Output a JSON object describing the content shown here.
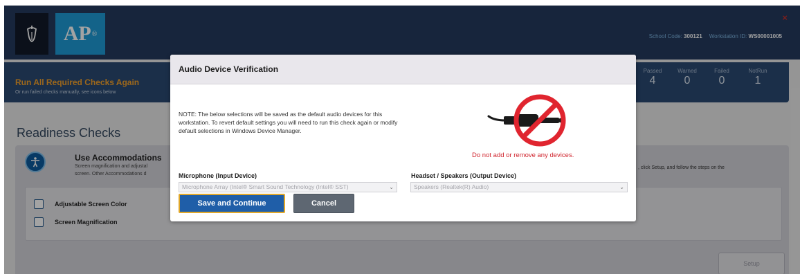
{
  "header": {
    "logo_text": "AP",
    "logo_mark": "®",
    "close_label": "×",
    "school_code_label": "School Code:",
    "school_code_value": "300121",
    "workstation_label": "Workstation ID:",
    "workstation_value": "WS00001005"
  },
  "run_bar": {
    "title": "Run All Required Checks Again",
    "subtitle": "Or run failed checks manually, see icons below",
    "stats": [
      {
        "label": "Passed",
        "value": "4"
      },
      {
        "label": "Warned",
        "value": "0"
      },
      {
        "label": "Failed",
        "value": "0"
      },
      {
        "label": "NotRun",
        "value": "1"
      }
    ]
  },
  "readiness": {
    "title": "Readiness Checks",
    "accommodations": {
      "title": "Use Accommodations",
      "desc_line1": "Screen magnification and adjustal",
      "desc_line2": "screen. Other Accommodations d",
      "desc_right": ", click Setup, and follow the steps on the",
      "options": [
        "Adjustable Screen Color",
        "Screen Magnification"
      ],
      "setup_label": "Setup"
    }
  },
  "modal": {
    "title": "Audio Device Verification",
    "note": "NOTE: The below selections will be saved as the default audio devices for this workstation. To revert default settings you will need to run this check again or modify default selections in Windows Device Manager.",
    "warning": "Do not add or remove any devices.",
    "mic_label": "Microphone (Input Device)",
    "mic_value": "Microphone Array (Intel® Smart Sound Technology (Intel® SST)",
    "speaker_label": "Headset / Speakers (Output Device)",
    "speaker_value": "Speakers (Realtek(R) Audio)",
    "save_label": "Save and Continue",
    "cancel_label": "Cancel"
  },
  "colors": {
    "header_bg": "#243a5e",
    "accent_orange": "#f3a12c",
    "primary_button": "#1f5ea8",
    "cancel_button": "#5e6772",
    "warning_red": "#d0252e"
  },
  "icons": [
    "college-board-acorn-icon",
    "close-icon",
    "accessibility-icon",
    "no-plug-icon",
    "chevron-down-icon"
  ]
}
